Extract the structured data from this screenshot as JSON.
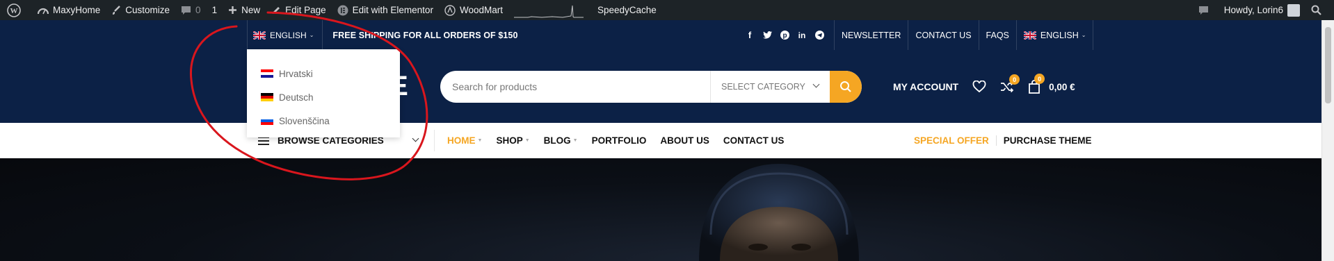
{
  "adminbar": {
    "site_name": "MaxyHome",
    "customize": "Customize",
    "comments_count": "0",
    "updates_count": "1",
    "new_label": "New",
    "edit_page": "Edit Page",
    "edit_elementor": "Edit with Elementor",
    "woodmart": "WoodMart",
    "speedycache": "SpeedyCache",
    "howdy": "Howdy, Lorin6"
  },
  "topbar": {
    "language": "ENGLISH",
    "shipping": "FREE SHIPPING FOR ALL ORDERS OF $150",
    "social_icons": [
      "facebook-icon",
      "twitter-icon",
      "pinterest-icon",
      "linkedin-icon",
      "telegram-icon"
    ],
    "links": [
      "NEWSLETTER",
      "CONTACT US",
      "FAQS"
    ],
    "language_right": "ENGLISH"
  },
  "language_dropdown": {
    "items": [
      {
        "label": "Hrvatski",
        "flag": [
          "#ff0000",
          "#ffffff",
          "#171796"
        ]
      },
      {
        "label": "Deutsch",
        "flag": [
          "#000000",
          "#dd0000",
          "#ffce00"
        ]
      },
      {
        "label": "Slovenščina",
        "flag": [
          "#ffffff",
          "#005ce5",
          "#ff0000"
        ]
      }
    ]
  },
  "header": {
    "logo_fragment": "IE",
    "search_placeholder": "Search for products",
    "select_category": "SELECT CATEGORY",
    "my_account": "MY ACCOUNT",
    "compare_count": "0",
    "cart_count": "0",
    "cart_total": "0,00 €"
  },
  "nav": {
    "browse": "BROWSE CATEGORIES",
    "menu": [
      "HOME",
      "SHOP",
      "BLOG",
      "PORTFOLIO",
      "ABOUT US",
      "CONTACT US"
    ],
    "special_offer": "SPECIAL OFFER",
    "purchase_theme": "PURCHASE THEME"
  },
  "colors": {
    "navy": "#0c2146",
    "accent": "#f5a623",
    "admin_bar": "#1d2327",
    "annotation": "#d9161d"
  }
}
